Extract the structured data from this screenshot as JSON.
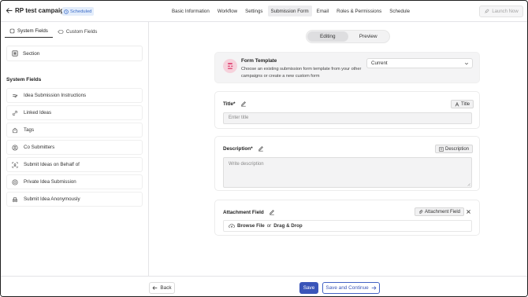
{
  "header": {
    "title": "RP test campaign",
    "status_badge": "Scheduled",
    "nav": [
      "Basic Information",
      "Workflow",
      "Settings",
      "Submission Form",
      "Email",
      "Roles & Permissions",
      "Schedule"
    ],
    "active_nav": "Submission Form",
    "launch_label": "Launch Now"
  },
  "sidebar": {
    "tabs": [
      "System Fields",
      "Custom Fields"
    ],
    "active_tab": "System Fields",
    "section_label": "Section",
    "heading": "System Fields",
    "items": [
      {
        "label": "Idea Submission Instructions",
        "icon": "instructions-icon"
      },
      {
        "label": "Linked Ideas",
        "icon": "link-icon"
      },
      {
        "label": "Tags",
        "icon": "tag-icon"
      },
      {
        "label": "Co Submitters",
        "icon": "user-circle-icon"
      },
      {
        "label": "Submit Ideas on Behalf of",
        "icon": "user-focus-icon"
      },
      {
        "label": "Private Idea Submission",
        "icon": "private-icon"
      },
      {
        "label": "Submit Idea Anonymously",
        "icon": "incognito-icon"
      }
    ]
  },
  "main": {
    "toggle": {
      "editing": "Editing",
      "preview": "Preview",
      "active": "Editing"
    },
    "template": {
      "title": "Form Template",
      "description": "Choose an existing submission form template from your other campaigns or create a new custom form",
      "select_value": "Current"
    },
    "title_field": {
      "label": "Title",
      "required_mark": "*",
      "chip": "Title",
      "placeholder": "Enter title"
    },
    "description_field": {
      "label": "Description",
      "required_mark": "*",
      "chip": "Description",
      "placeholder": "Write description"
    },
    "attachment_field": {
      "label": "Attachment Field",
      "chip": "Attachment Field",
      "browse": "Browse File",
      "or": "or",
      "drag": "Drag & Drop"
    }
  },
  "footer": {
    "back": "Back",
    "save": "Save",
    "save_continue": "Save and Continue"
  },
  "colors": {
    "primary": "#3a55b9",
    "badge_bg": "#e3edfb",
    "badge_text": "#3b6bc7",
    "avatar": "#f6d2dc"
  }
}
